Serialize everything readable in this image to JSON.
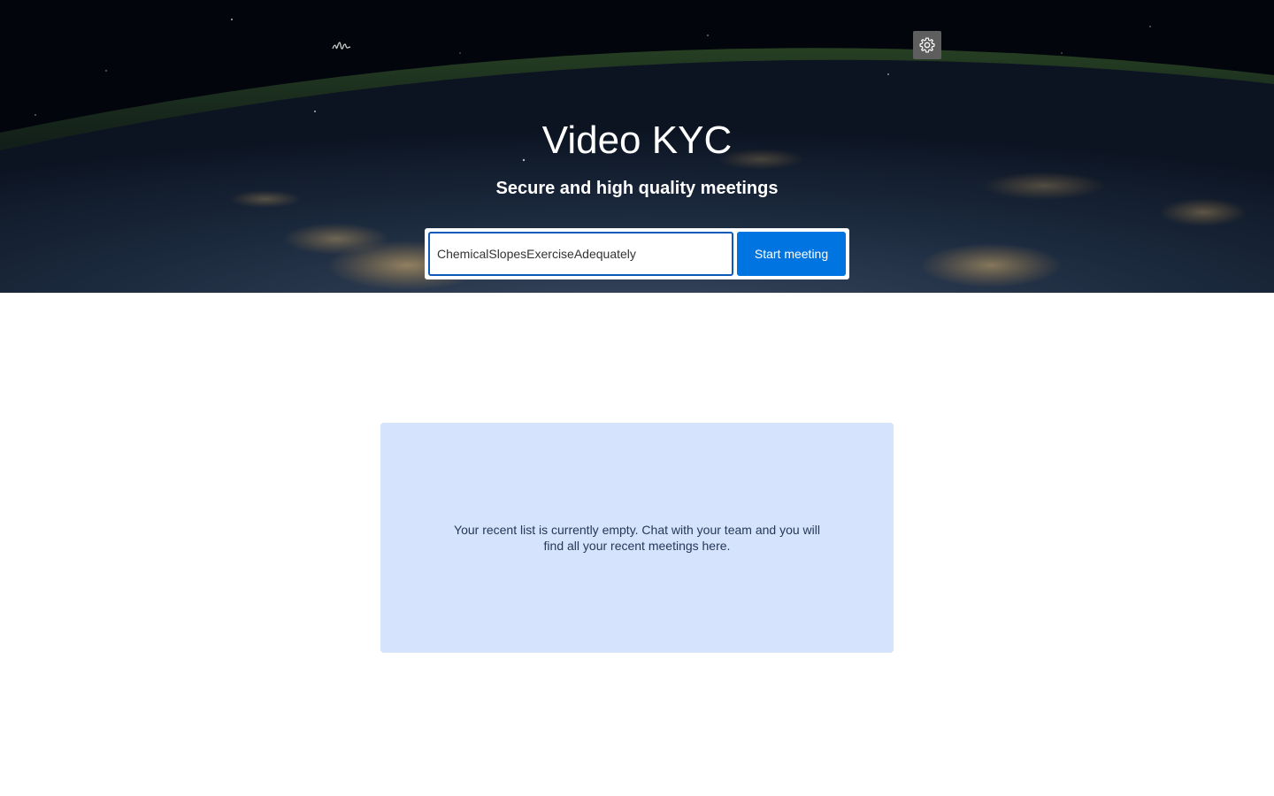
{
  "app": {
    "title": "Video KYC",
    "subtitle": "Secure and high quality meetings"
  },
  "header": {
    "logo_icon": "watermark-logo-icon",
    "settings_icon": "gear-icon"
  },
  "meeting": {
    "room_name_value": "ChemicalSlopesExerciseAdequately",
    "start_label": "Start meeting"
  },
  "recent": {
    "empty_message": "Your recent list is currently empty. Chat with your team and you will find all your recent meetings here."
  },
  "colors": {
    "accent": "#0074e0",
    "input_border": "#0c5bbb",
    "panel_background": "#d5e3fc",
    "settings_button": "#5e5e5e",
    "panel_text": "#253858"
  }
}
